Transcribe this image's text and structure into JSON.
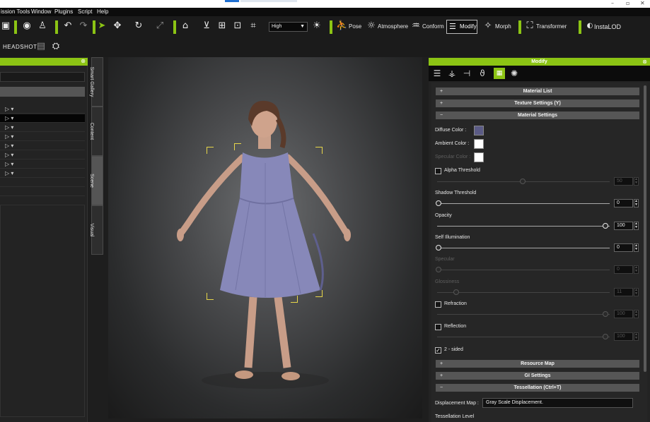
{
  "window": {
    "controls": [
      "–",
      "▫",
      "✕"
    ]
  },
  "menubar": {
    "items": [
      "ission Tools",
      "Window",
      "Plugins",
      "Script",
      "Help"
    ]
  },
  "toolbar": {
    "quality": "High",
    "buttons": {
      "pose": "Pose",
      "atmosphere": "Atmosphere",
      "conform": "Conform",
      "modify": "Modify",
      "morph": "Morph",
      "transformer": "Transformer",
      "instalod": "InstaLOD"
    }
  },
  "subbar": {
    "headshot": "HEADSHOT"
  },
  "side_tabs": [
    "Smart Gallery",
    "Content",
    "Scene",
    "Visual"
  ],
  "modify_panel": {
    "title": "Modify",
    "sections": {
      "material_list": "Material List",
      "texture_settings": "Texture Settings  (Y)",
      "material_settings": "Material Settings",
      "resource_map": "Resource Map",
      "gi_settings": "GI Settings",
      "tessellation": "Tessellation  (Ctrl+T)"
    },
    "colors": {
      "diffuse_label": "Diffuse Color :",
      "ambient_label": "Ambient Color :",
      "specular_label": "Specular Color :",
      "diffuse_hex": "#5b5b86",
      "ambient_hex": "#ffffff",
      "specular_hex": "#ffffff"
    },
    "alpha_threshold": {
      "label": "Alpha Threshold",
      "value": "50"
    },
    "shadow_threshold": {
      "label": "Shadow Threshold",
      "value": "0"
    },
    "opacity": {
      "label": "Opacity",
      "value": "100"
    },
    "self_illumination": {
      "label": "Self Illumination",
      "value": "0"
    },
    "specular": {
      "label": "Specular",
      "value": "0"
    },
    "glossiness": {
      "label": "Glossiness",
      "value": "11"
    },
    "refraction": {
      "label": "Refraction",
      "value": "100"
    },
    "reflection": {
      "label": "Reflection",
      "value": "100"
    },
    "two_sided": {
      "label": "2 - sided",
      "checked": true
    },
    "displacement_label": "Displacement Map :",
    "displacement_value": "Gray Scale Displacement.",
    "tessellation_level": "Tessellation Level"
  },
  "accent": "#8cc414"
}
